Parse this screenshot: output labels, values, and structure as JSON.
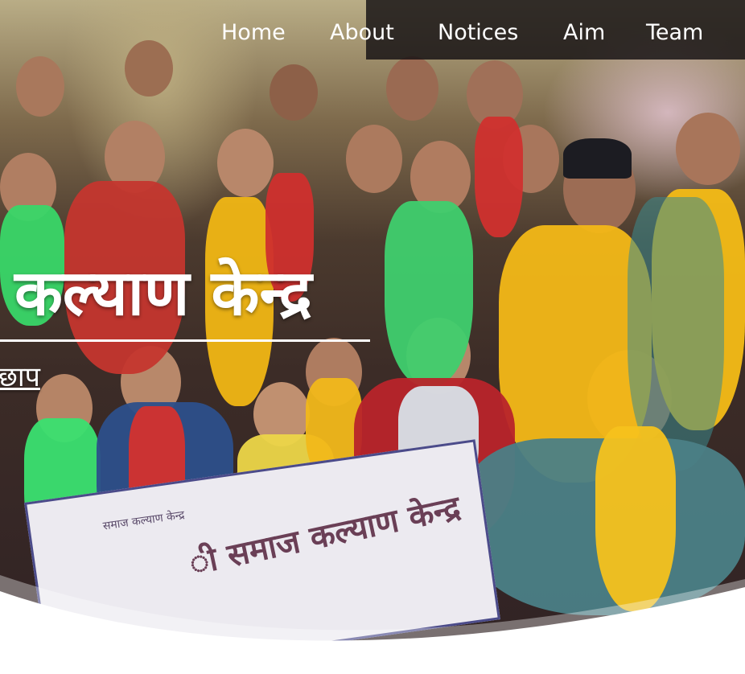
{
  "nav": {
    "items": [
      {
        "label": "Home"
      },
      {
        "label": "About"
      },
      {
        "label": "Notices"
      },
      {
        "label": "Aim"
      },
      {
        "label": "Team"
      }
    ]
  },
  "hero": {
    "title": "कल्याण केन्द्र",
    "subtitle": "छाप",
    "banner_text": "ी समाज कल्याण केन्द्र",
    "banner_small": "समाज कल्याण केन्द्र"
  },
  "colors": {
    "nav_background": "#141012",
    "text": "#ffffff",
    "wave": "#ffffff"
  }
}
